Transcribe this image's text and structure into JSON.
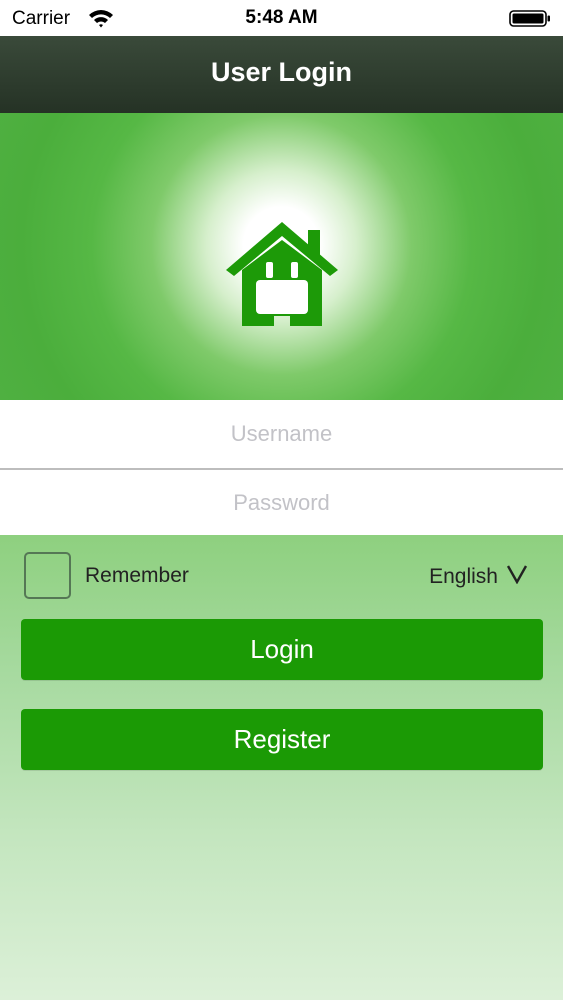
{
  "status_bar": {
    "carrier": "Carrier",
    "time": "5:48 AM",
    "wifi_icon": "wifi-icon",
    "battery_icon": "battery-full-icon"
  },
  "nav": {
    "title": "User Login"
  },
  "hero": {
    "logo_icon": "house-plug-icon",
    "accent": "#1b9a05"
  },
  "form": {
    "username_placeholder": "Username",
    "username_value": "",
    "password_placeholder": "Password",
    "password_value": "",
    "remember_label": "Remember",
    "remember_checked": false,
    "language": "English",
    "language_icon": "chevron-down-icon"
  },
  "buttons": {
    "login_label": "Login",
    "register_label": "Register",
    "color": "#1b9a05"
  }
}
